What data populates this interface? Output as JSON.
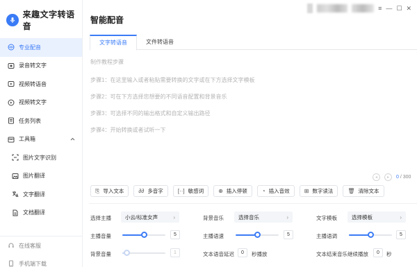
{
  "app": {
    "name": "来趣文字转语音"
  },
  "window": {
    "controls": [
      "≡",
      "—",
      "☐",
      "✕"
    ]
  },
  "sidebar": {
    "items": [
      {
        "label": "专业配音",
        "icon": "mic-waves-icon",
        "active": true
      },
      {
        "label": "录音转文字",
        "icon": "record-icon"
      },
      {
        "label": "视频转语音",
        "icon": "video-play-icon"
      },
      {
        "label": "视频转文字",
        "icon": "video-text-icon"
      },
      {
        "label": "任务列表",
        "icon": "task-list-icon"
      },
      {
        "label": "工具箱",
        "icon": "toolbox-icon",
        "expanded": true
      },
      {
        "label": "图片文字识别",
        "icon": "scan-icon",
        "sub": true
      },
      {
        "label": "图片翻译",
        "icon": "image-icon",
        "sub": true
      },
      {
        "label": "文字翻译",
        "icon": "translate-icon",
        "sub": true
      },
      {
        "label": "文档翻译",
        "icon": "document-icon",
        "sub": true
      }
    ],
    "bottom": [
      {
        "label": "在线客服",
        "icon": "service-icon"
      },
      {
        "label": "手机端下载",
        "icon": "phone-icon"
      }
    ]
  },
  "main": {
    "title": "智能配音",
    "tabs": [
      {
        "label": "文字转语音",
        "active": true
      },
      {
        "label": "文件转语音",
        "active": false
      }
    ],
    "editor": {
      "lines": [
        "制作教程步骤",
        "步骤1：在这里输入或者粘贴需要转换的文字或在下方选择文字模板",
        "步骤2：可在下方选择您想要的不同语音配置和背景音乐",
        "步骤3：可选择不同的输出格式和自定义输出路径",
        "步骤4：开始转换或者试听一下"
      ]
    },
    "counter": {
      "current": "0",
      "max": "/ 300"
    },
    "toolbar": [
      {
        "label": "导入文本",
        "icon": "import-icon"
      },
      {
        "label": "多音字",
        "icon": "polyphone-icon"
      },
      {
        "label": "敏感词",
        "icon": "sensitive-word-icon"
      },
      {
        "label": "插入停顿",
        "icon": "pause-insert-icon"
      },
      {
        "label": "插入音效",
        "icon": "sound-effect-icon"
      },
      {
        "label": "数字读法",
        "icon": "number-read-icon"
      },
      {
        "label": "清除文本",
        "icon": "trash-icon"
      }
    ],
    "settings": {
      "anchor_label": "选择主播",
      "anchor_value": "小云/标准女声",
      "bgm_label": "背景音乐",
      "bgm_value": "选择音乐",
      "template_label": "文字模板",
      "template_value": "选择模板",
      "volume_label": "主播音量",
      "volume_value": "5",
      "volume_level": 0.5,
      "speed_label": "主播语速",
      "speed_value": "5",
      "speed_level": 0.5,
      "pitch_label": "主播语调",
      "pitch_value": "5",
      "pitch_level": 0.5,
      "bgm_volume_label": "背景音量",
      "bgm_volume_value": "1",
      "bgm_volume_level": 0.1,
      "delay_label": "文本语音延迟",
      "delay_value": "0",
      "delay_suffix": "秒播放",
      "bgm_delay_label": "文本结束音乐继续播放",
      "bgm_delay_value": "0",
      "bgm_delay_suffix": "秒"
    }
  }
}
